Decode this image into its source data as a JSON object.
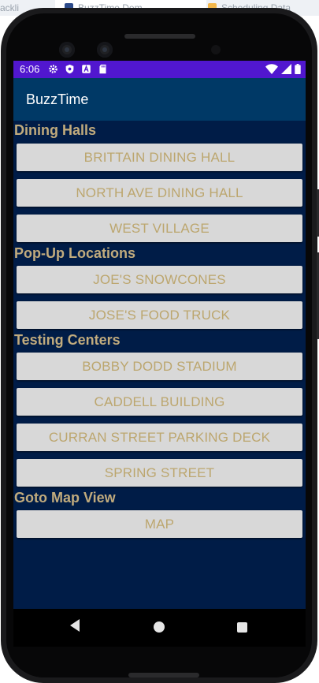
{
  "background_tabs": {
    "tab1": "ackli",
    "tab2": "BuzzTime Dem",
    "tab3": "Scheduling Data"
  },
  "statusbar": {
    "time": "6:06",
    "icons": [
      "gear-icon",
      "shield-icon",
      "a-icon",
      "sd-card-icon"
    ],
    "right_icons": [
      "wifi-icon",
      "cell-signal-icon",
      "battery-icon"
    ]
  },
  "appbar": {
    "title": "BuzzTime"
  },
  "sections": {
    "dining": {
      "title": "Dining Halls",
      "buttons": [
        "BRITTAIN DINING HALL",
        "NORTH AVE DINING HALL",
        "WEST VILLAGE"
      ]
    },
    "popup": {
      "title": "Pop-Up Locations",
      "buttons": [
        "JOE'S SNOWCONES",
        "JOSE'S FOOD TRUCK"
      ]
    },
    "testing": {
      "title": "Testing Centers",
      "buttons": [
        "BOBBY DODD STADIUM",
        "CADDELL BUILDING",
        "CURRAN STREET PARKING DECK",
        "SPRING STREET"
      ]
    },
    "map": {
      "title": "Goto Map View",
      "buttons": [
        "MAP"
      ]
    }
  },
  "navbar": {
    "items": [
      "back-icon",
      "home-icon",
      "recents-icon"
    ]
  },
  "colors": {
    "statusbar": "#5117cf",
    "appbar": "#003966",
    "screen_background": "#001c47",
    "section_title": "#c1ab7d",
    "button_background": "#d8d8d8",
    "button_text": "#bca66e"
  }
}
